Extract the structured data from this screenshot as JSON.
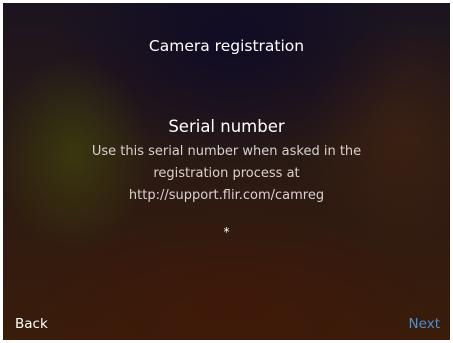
{
  "screen": {
    "title": "Camera registration",
    "heading": "Serial number",
    "description": "Use this serial number when asked in the registration process at http://support.flir.com/camreg",
    "serial_value": "*"
  },
  "navigation": {
    "back_label": "Back",
    "next_label": "Next"
  },
  "colors": {
    "next_accent": "#4d8fd6",
    "text_primary": "#ffffff",
    "text_secondary": "#d8d2cc"
  }
}
